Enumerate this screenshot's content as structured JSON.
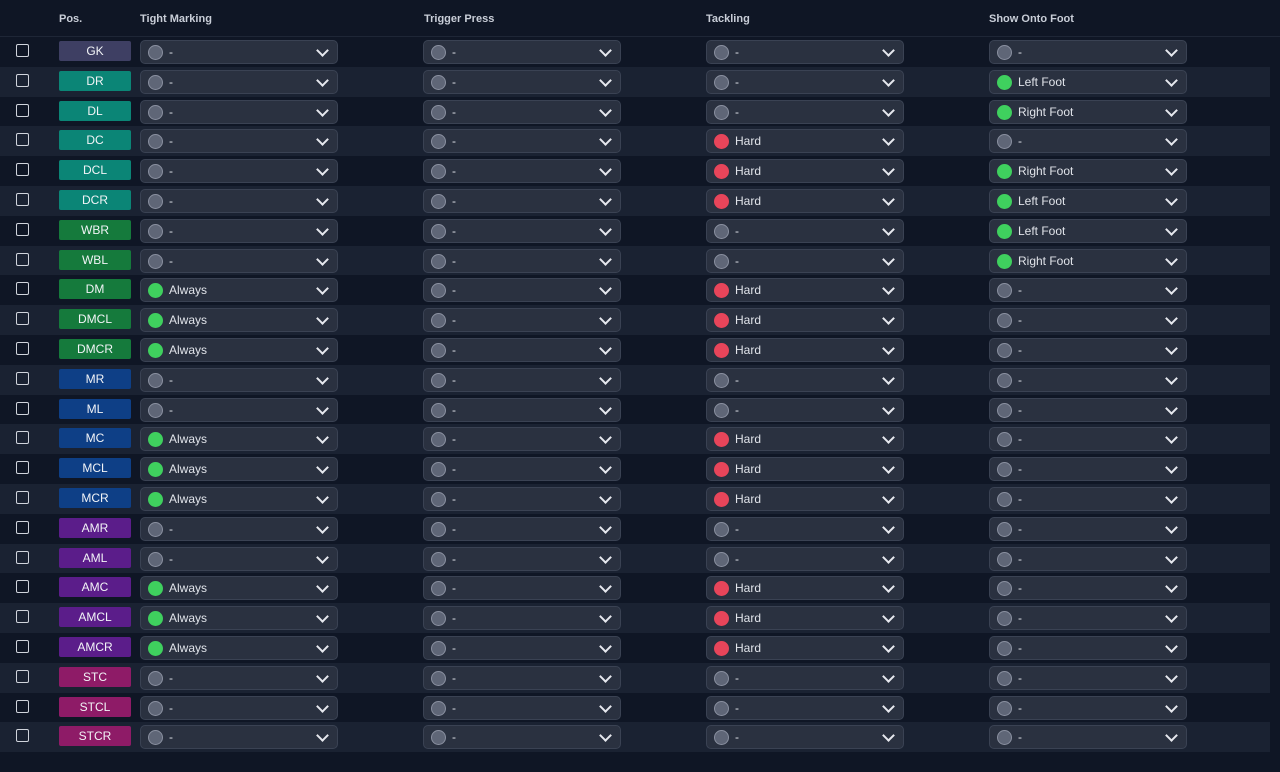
{
  "headers": {
    "pos": "Pos.",
    "tight_marking": "Tight Marking",
    "trigger_press": "Trigger Press",
    "tackling": "Tackling",
    "show_onto_foot": "Show Onto Foot"
  },
  "colors": {
    "gk": "#3e3f63",
    "defender": "#0b8576",
    "wingback_dm": "#157a3c",
    "midfield": "#0e3f86",
    "attacking_mid": "#5b1d8a",
    "striker": "#8e1b67",
    "green": "#3fd05e",
    "red": "#e8455a"
  },
  "rows": [
    {
      "pos": "GK",
      "group": "gk",
      "tight": "-",
      "trigger": "-",
      "tackling": "-",
      "foot": "-"
    },
    {
      "pos": "DR",
      "group": "defender",
      "tight": "-",
      "trigger": "-",
      "tackling": "-",
      "foot": "Left Foot"
    },
    {
      "pos": "DL",
      "group": "defender",
      "tight": "-",
      "trigger": "-",
      "tackling": "-",
      "foot": "Right Foot"
    },
    {
      "pos": "DC",
      "group": "defender",
      "tight": "-",
      "trigger": "-",
      "tackling": "Hard",
      "foot": "-"
    },
    {
      "pos": "DCL",
      "group": "defender",
      "tight": "-",
      "trigger": "-",
      "tackling": "Hard",
      "foot": "Right Foot"
    },
    {
      "pos": "DCR",
      "group": "defender",
      "tight": "-",
      "trigger": "-",
      "tackling": "Hard",
      "foot": "Left Foot"
    },
    {
      "pos": "WBR",
      "group": "wingback_dm",
      "tight": "-",
      "trigger": "-",
      "tackling": "-",
      "foot": "Left Foot"
    },
    {
      "pos": "WBL",
      "group": "wingback_dm",
      "tight": "-",
      "trigger": "-",
      "tackling": "-",
      "foot": "Right Foot"
    },
    {
      "pos": "DM",
      "group": "wingback_dm",
      "tight": "Always",
      "trigger": "-",
      "tackling": "Hard",
      "foot": "-"
    },
    {
      "pos": "DMCL",
      "group": "wingback_dm",
      "tight": "Always",
      "trigger": "-",
      "tackling": "Hard",
      "foot": "-"
    },
    {
      "pos": "DMCR",
      "group": "wingback_dm",
      "tight": "Always",
      "trigger": "-",
      "tackling": "Hard",
      "foot": "-"
    },
    {
      "pos": "MR",
      "group": "midfield",
      "tight": "-",
      "trigger": "-",
      "tackling": "-",
      "foot": "-"
    },
    {
      "pos": "ML",
      "group": "midfield",
      "tight": "-",
      "trigger": "-",
      "tackling": "-",
      "foot": "-"
    },
    {
      "pos": "MC",
      "group": "midfield",
      "tight": "Always",
      "trigger": "-",
      "tackling": "Hard",
      "foot": "-"
    },
    {
      "pos": "MCL",
      "group": "midfield",
      "tight": "Always",
      "trigger": "-",
      "tackling": "Hard",
      "foot": "-"
    },
    {
      "pos": "MCR",
      "group": "midfield",
      "tight": "Always",
      "trigger": "-",
      "tackling": "Hard",
      "foot": "-"
    },
    {
      "pos": "AMR",
      "group": "attacking_mid",
      "tight": "-",
      "trigger": "-",
      "tackling": "-",
      "foot": "-"
    },
    {
      "pos": "AML",
      "group": "attacking_mid",
      "tight": "-",
      "trigger": "-",
      "tackling": "-",
      "foot": "-"
    },
    {
      "pos": "AMC",
      "group": "attacking_mid",
      "tight": "Always",
      "trigger": "-",
      "tackling": "Hard",
      "foot": "-"
    },
    {
      "pos": "AMCL",
      "group": "attacking_mid",
      "tight": "Always",
      "trigger": "-",
      "tackling": "Hard",
      "foot": "-"
    },
    {
      "pos": "AMCR",
      "group": "attacking_mid",
      "tight": "Always",
      "trigger": "-",
      "tackling": "Hard",
      "foot": "-"
    },
    {
      "pos": "STC",
      "group": "striker",
      "tight": "-",
      "trigger": "-",
      "tackling": "-",
      "foot": "-"
    },
    {
      "pos": "STCL",
      "group": "striker",
      "tight": "-",
      "trigger": "-",
      "tackling": "-",
      "foot": "-"
    },
    {
      "pos": "STCR",
      "group": "striker",
      "tight": "-",
      "trigger": "-",
      "tackling": "-",
      "foot": "-"
    }
  ]
}
